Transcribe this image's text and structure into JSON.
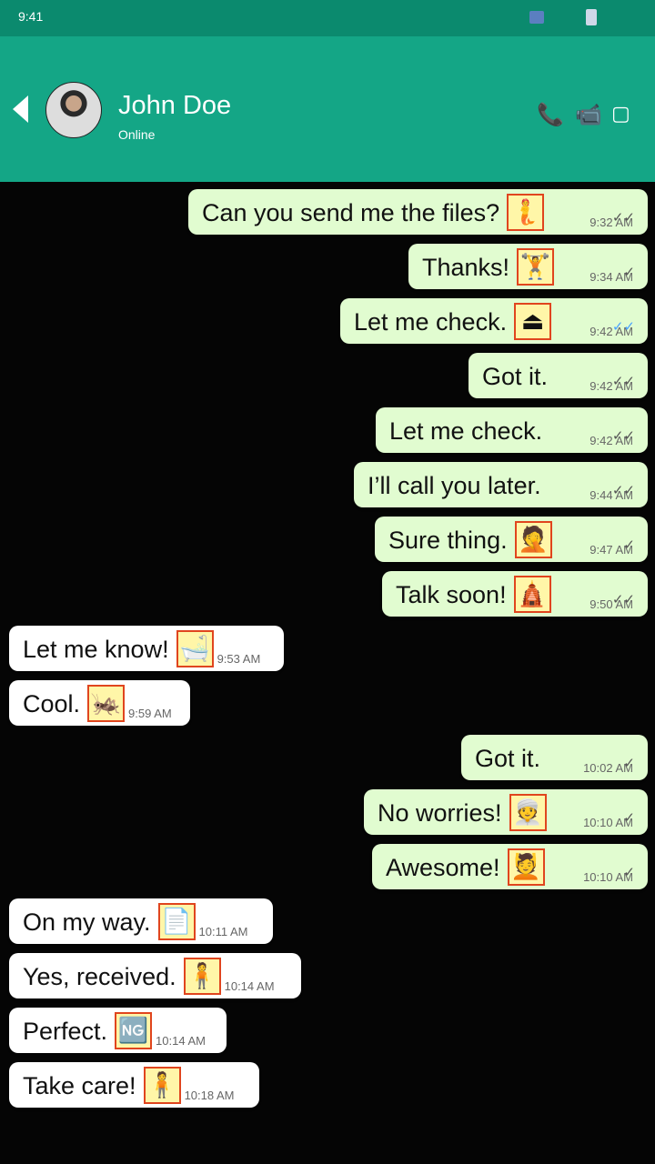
{
  "status": {
    "time": "9:41"
  },
  "header": {
    "name": "John Doe",
    "presence": "Online"
  },
  "messages": [
    {
      "dir": "out",
      "text": "Can you send me the files?",
      "emoji": "🧜",
      "time": "9:32 AM",
      "tick": "✓✓"
    },
    {
      "dir": "out",
      "text": "Thanks!",
      "emoji": "🏋",
      "time": "9:34 AM",
      "tick": "✓"
    },
    {
      "dir": "out",
      "text": "Let me check.",
      "emoji": "⏏",
      "time": "9:42 AM",
      "tick": "✓✓",
      "tick_color": "blue"
    },
    {
      "dir": "out",
      "text": "Got it.",
      "emoji": "",
      "time": "9:42 AM",
      "tick": "✓✓"
    },
    {
      "dir": "out",
      "text": "Let me check.",
      "emoji": "",
      "time": "9:42 AM",
      "tick": "✓✓"
    },
    {
      "dir": "out",
      "text": "I’ll call you later.",
      "emoji": "",
      "time": "9:44 AM",
      "tick": "✓✓"
    },
    {
      "dir": "out",
      "text": "Sure thing.",
      "emoji": "🤦",
      "time": "9:47 AM",
      "tick": "✓"
    },
    {
      "dir": "out",
      "text": "Talk soon!",
      "emoji": "🛕",
      "time": "9:50 AM",
      "tick": "✓✓"
    },
    {
      "dir": "in",
      "text": "Let me know!",
      "emoji": "🛁",
      "time": "9:53 AM"
    },
    {
      "dir": "in",
      "text": "Cool.",
      "emoji": "🦗",
      "time": "9:59 AM"
    },
    {
      "dir": "out",
      "text": "Got it.",
      "emoji": "",
      "time": "10:02 AM",
      "tick": "✓"
    },
    {
      "dir": "out",
      "text": "No worries!",
      "emoji": "👳",
      "time": "10:10 AM",
      "tick": "✓"
    },
    {
      "dir": "out",
      "text": "Awesome!",
      "emoji": "💆",
      "time": "10:10 AM",
      "tick": "✓"
    },
    {
      "dir": "in",
      "text": "On my way.",
      "emoji": "📄",
      "time": "10:11 AM"
    },
    {
      "dir": "in",
      "text": "Yes, received.",
      "emoji": "🧍",
      "time": "10:14 AM"
    },
    {
      "dir": "in",
      "text": "Perfect.",
      "emoji": "🆖",
      "time": "10:14 AM"
    },
    {
      "dir": "in",
      "text": "Take care!",
      "emoji": "🧍",
      "time": "10:18 AM"
    }
  ]
}
